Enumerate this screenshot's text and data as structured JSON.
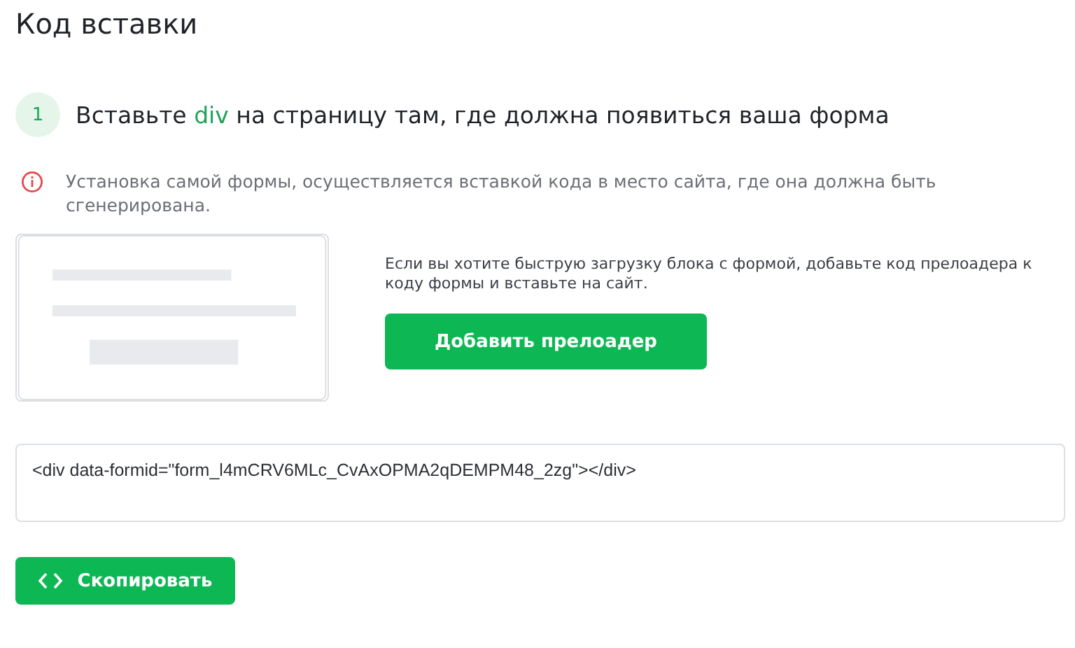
{
  "title": "Код вставки",
  "step": {
    "number": "1",
    "before": "Вставьте ",
    "code": "div",
    "after": " на страницу там, где должна появиться ваша форма"
  },
  "notice": "Установка самой формы, осуществляется вставкой кода в место сайта, где она должна быть сгенерирована.",
  "preloader": {
    "hint": "Если вы хотите быструю загрузку блока с формой, добавьте код прелоадера к коду формы и вставьте на сайт.",
    "button": "Добавить прелоадер"
  },
  "code_field": {
    "value": "<div data-formid=\"form_l4mCRV6MLc_CvAxOPMA2qDEMPM48_2zg\"></div>"
  },
  "copy_button": "Скопировать"
}
